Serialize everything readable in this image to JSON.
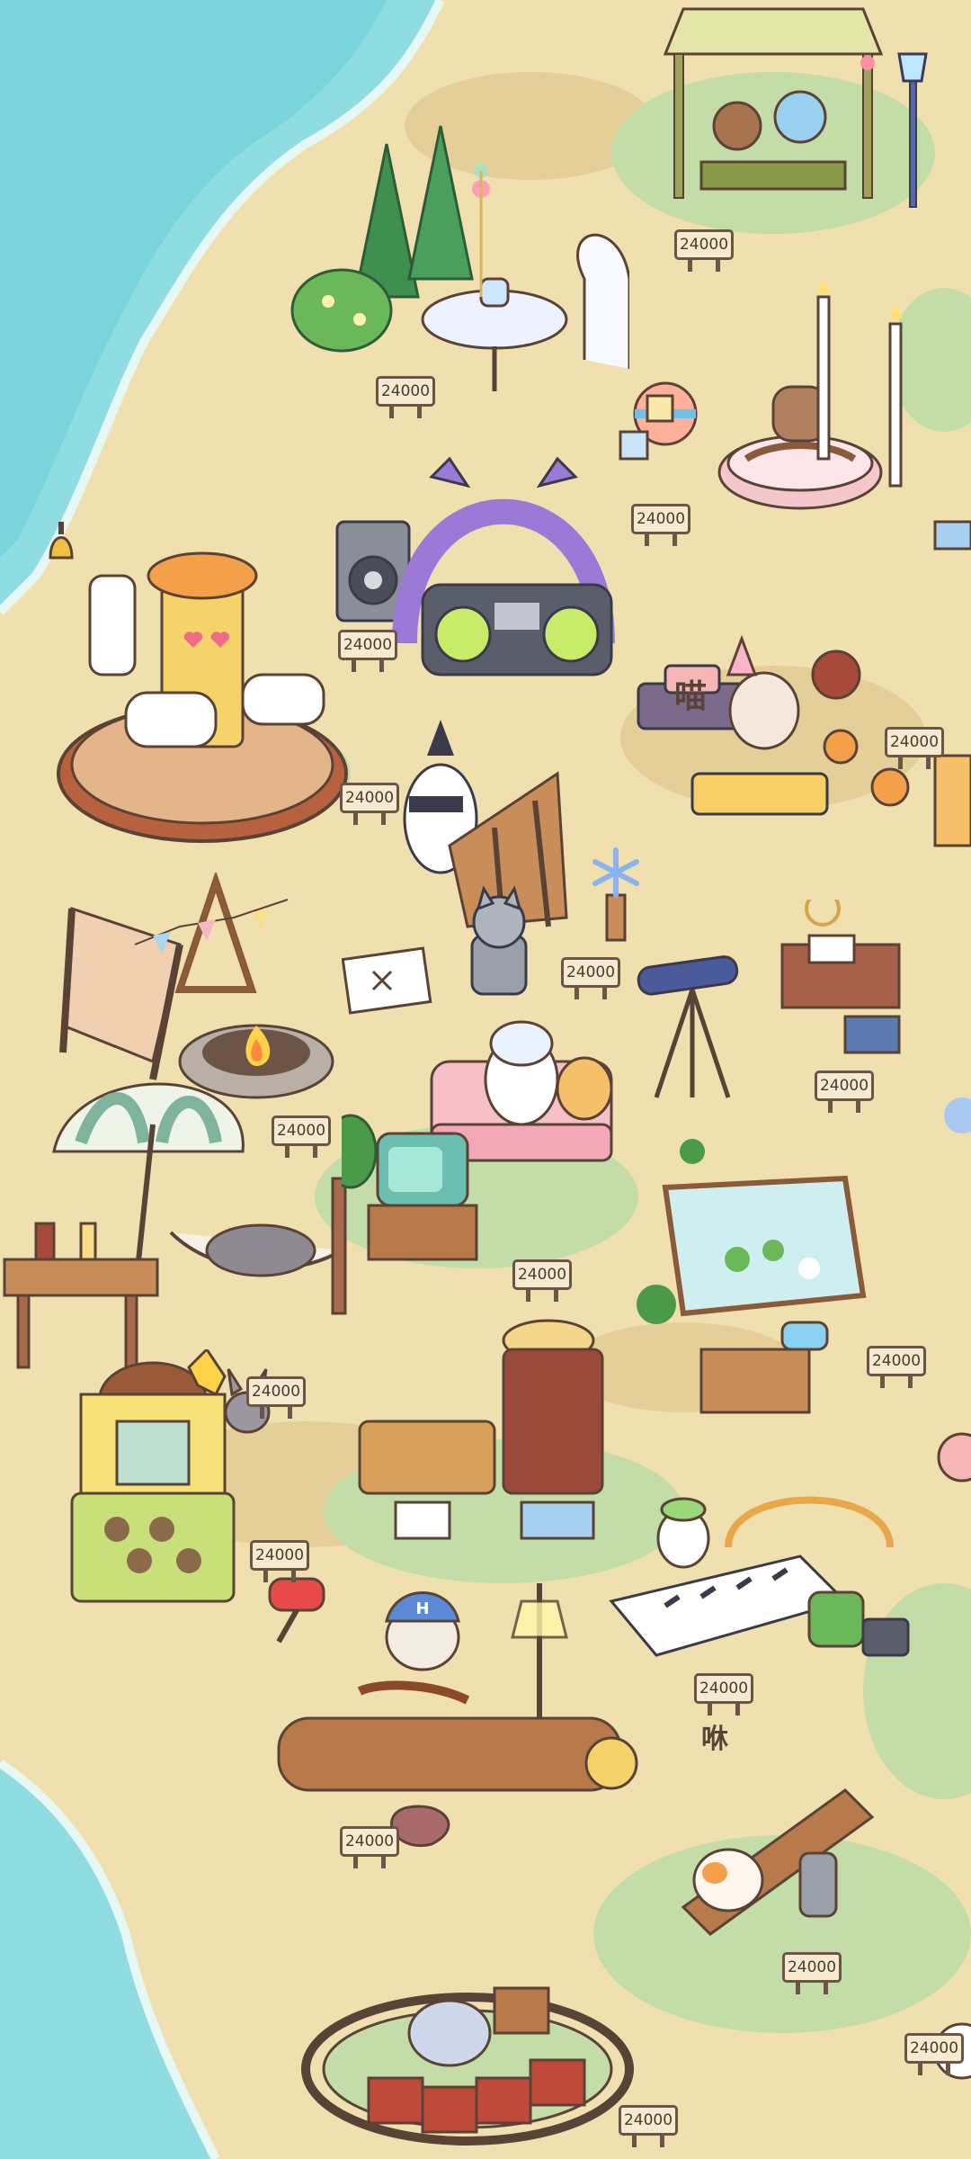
{
  "price": "24000",
  "cat_sound_1": "喵",
  "cat_sound_2": "咻",
  "hat_letter": "H",
  "colors": {
    "sand": "#f0e0b0",
    "sea": "#8fdde0",
    "grass": "#c4dca8",
    "outline": "#5a4236",
    "sign_bg": "#f6ead0"
  }
}
